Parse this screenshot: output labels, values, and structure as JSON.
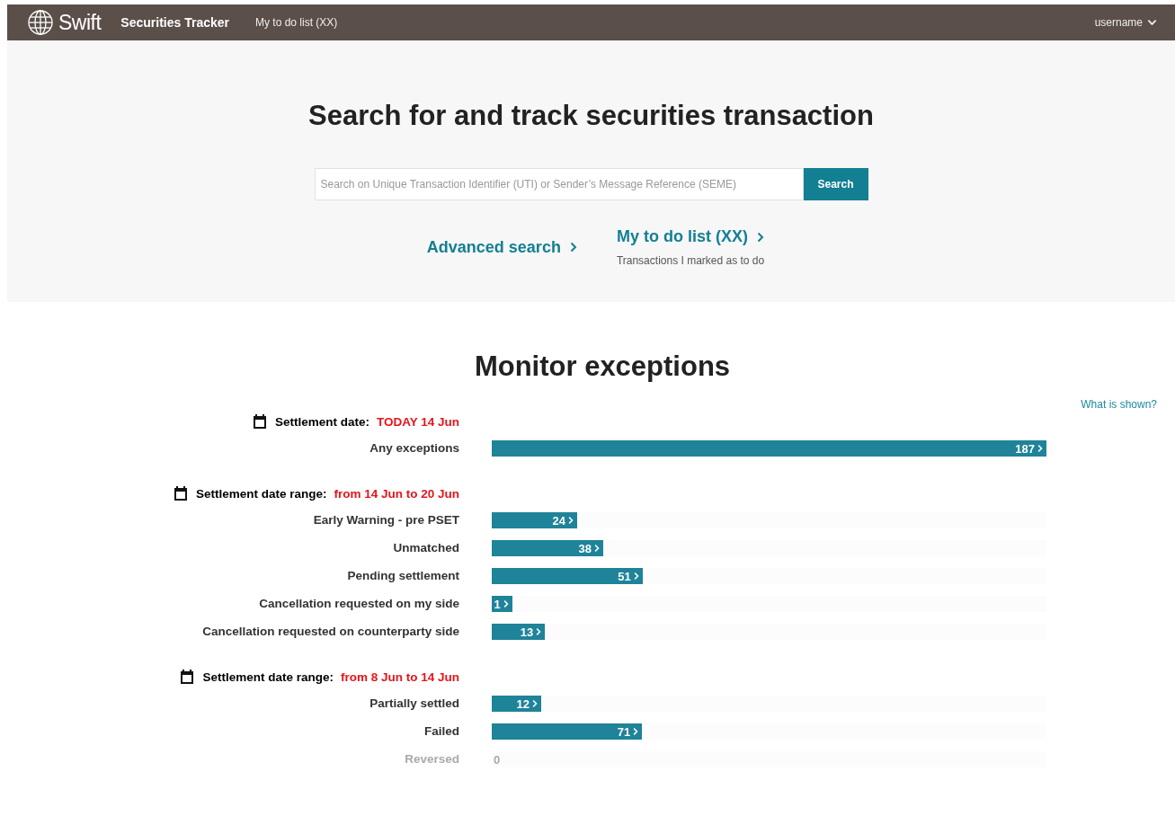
{
  "nav": {
    "logo": "Swift",
    "app_title": "Securities Tracker",
    "todo_link": "My to do list (XX)",
    "user": "username"
  },
  "search": {
    "title": "Search for and track securities transaction",
    "placeholder": "Search on Unique Transaction Identifier (UTI) or Sender’s Message Reference (SEME)",
    "button": "Search",
    "advanced_link": "Advanced search",
    "todo_link": "My to do list (XX)",
    "todo_caption": "Transactions I marked as to do"
  },
  "monitor": {
    "title": "Monitor exceptions",
    "help_link": "What is shown?",
    "groups": [
      {
        "label": "Settlement date:",
        "value": "TODAY 14 Jun",
        "rows": [
          {
            "label": "Any exceptions",
            "count": "187",
            "level": 1.0,
            "disabled": false
          }
        ]
      },
      {
        "label": "Settlement date range:",
        "value": "from 14 Jun to 20 Jun",
        "rows": [
          {
            "label": "Early Warning - pre PSET",
            "count": "24",
            "level": 0.154,
            "disabled": false
          },
          {
            "label": "Unmatched",
            "count": "38",
            "level": 0.201,
            "disabled": false
          },
          {
            "label": "Pending settlement",
            "count": "51",
            "level": 0.272,
            "disabled": false
          },
          {
            "label": "Cancellation requested on my side",
            "count": "1",
            "level": 0.037,
            "disabled": false
          },
          {
            "label": "Cancellation requested on counterparty side",
            "count": "13",
            "level": 0.096,
            "disabled": false
          }
        ]
      },
      {
        "label": "Settlement date range:",
        "value": "from 8 Jun to 14 Jun",
        "rows": [
          {
            "label": "Partially settled",
            "count": "12",
            "level": 0.089,
            "disabled": false
          },
          {
            "label": "Failed",
            "count": "71",
            "level": 0.271,
            "disabled": false
          },
          {
            "label": "Reversed",
            "count": "0",
            "disabled": true
          }
        ]
      }
    ]
  }
}
